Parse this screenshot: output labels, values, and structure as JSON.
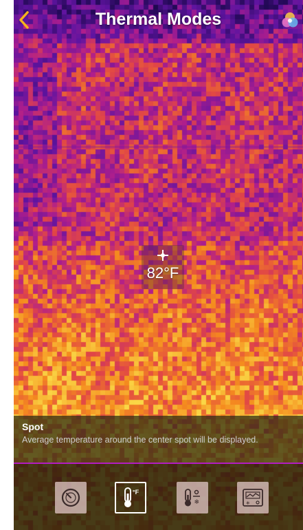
{
  "header": {
    "title": "Thermal Modes",
    "back_icon": "chevron-left-icon",
    "palette_icon": "color-palette-icon"
  },
  "spot": {
    "temperature": "82°F",
    "icon": "crosshair-icon"
  },
  "info": {
    "title": "Spot",
    "description": "Average temperature around the center spot will be displayed."
  },
  "toolbar": {
    "modes": [
      {
        "icon": "dial-icon",
        "active": false
      },
      {
        "icon": "thermometer-fahrenheit-icon",
        "label": "°F",
        "active": true
      },
      {
        "icon": "thermometer-range-icon",
        "active": false
      },
      {
        "icon": "graph-panel-icon",
        "active": false
      }
    ]
  },
  "colors": {
    "accent": "#f5b31c",
    "divider": "#b21cc2",
    "thermal_cold": "#2a0a6a",
    "thermal_mid": "#c0208a",
    "thermal_warm": "#f07a20",
    "thermal_hot": "#f8d040"
  }
}
